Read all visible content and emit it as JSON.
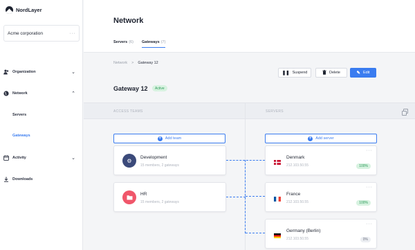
{
  "brand": {
    "name": "NordLayer"
  },
  "org": {
    "name": "Acme corporation",
    "menu": "···"
  },
  "sidebar": {
    "items": [
      {
        "label": "Organization",
        "icon": "users-icon"
      },
      {
        "label": "Network",
        "icon": "globe-icon"
      },
      {
        "label": "Activity",
        "icon": "calendar-icon"
      },
      {
        "label": "Downloads",
        "icon": "download-icon"
      }
    ],
    "network_sub": [
      {
        "label": "Servers"
      },
      {
        "label": "Gateways"
      }
    ]
  },
  "header": {
    "title": "Network",
    "tabs": [
      {
        "label": "Servers",
        "count": "(6)"
      },
      {
        "label": "Gateways",
        "count": "(7)"
      }
    ]
  },
  "breadcrumb": {
    "root": "Network",
    "sep": ">",
    "current": "Gateway 12"
  },
  "actions": {
    "suspend": "Suspend",
    "delete": "Delete",
    "edit": "Edit"
  },
  "gateway": {
    "name": "Gateway 12",
    "status": "Active"
  },
  "columns": {
    "teams": "ACCESS TEAMS",
    "servers": "SERVERS"
  },
  "add_team": "Add team",
  "add_server": "Add server",
  "teams": [
    {
      "name": "Development",
      "meta": "15 members, 2 gateways",
      "color": "#3b4a7a",
      "icon": "gear-icon"
    },
    {
      "name": "HR",
      "meta": "15 members, 2 gateways",
      "color": "#f0566a",
      "icon": "folder-icon"
    }
  ],
  "servers": [
    {
      "name": "Denmark",
      "ip": "212.103.50.55",
      "load": "100%",
      "menu": "···"
    },
    {
      "name": "France",
      "ip": "212.103.50.55",
      "load": "100%",
      "menu": "···"
    },
    {
      "name": "Germany (Berlin)",
      "ip": "212.103.50.55",
      "load": "0%",
      "menu": "···"
    }
  ],
  "colors": {
    "accent": "#3a7cf0",
    "active_green": "#2c9b5a"
  }
}
